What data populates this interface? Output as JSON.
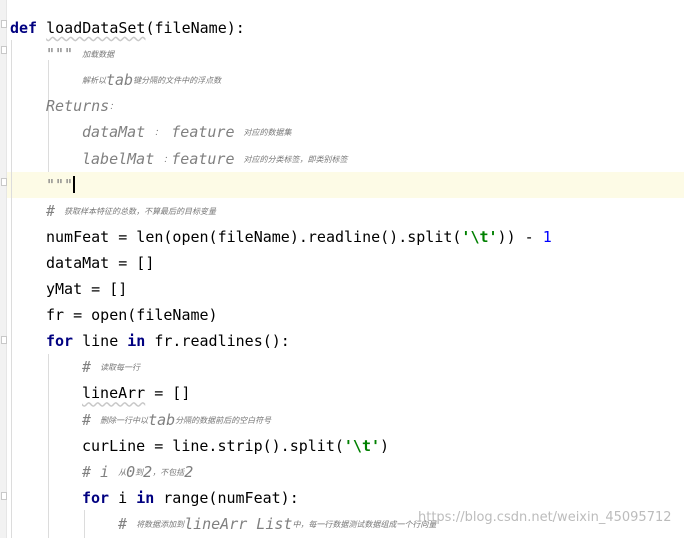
{
  "editor": {
    "lines": [
      {
        "id": "def",
        "indent": 0,
        "parts": [
          [
            "kw",
            "def "
          ],
          [
            "plain squig",
            "loadDataSet"
          ],
          [
            "plain",
            "(fileName):"
          ]
        ]
      },
      {
        "id": "doc-open",
        "indent": 1,
        "parts": [
          [
            "doc",
            "\"\"\" "
          ],
          [
            "tiny",
            "加载数据"
          ]
        ]
      },
      {
        "id": "doc-desc",
        "indent": 2,
        "parts": [
          [
            "tiny",
            "解析以"
          ],
          [
            "doc-i",
            "tab"
          ],
          [
            "tiny",
            "键分隔的文件中的浮点数"
          ]
        ]
      },
      {
        "id": "doc-returns",
        "indent": 1,
        "parts": [
          [
            "doc-i",
            "Returns"
          ],
          [
            "tiny",
            "："
          ]
        ]
      },
      {
        "id": "doc-datamat",
        "indent": 2,
        "parts": [
          [
            "doc-i",
            "dataMat "
          ],
          [
            "tiny",
            "："
          ],
          [
            "doc-i",
            " feature "
          ],
          [
            "tiny",
            "对应的数据集"
          ]
        ]
      },
      {
        "id": "doc-labelmat",
        "indent": 2,
        "parts": [
          [
            "doc-i",
            "labelMat "
          ],
          [
            "tiny",
            "："
          ],
          [
            "doc-i",
            "feature "
          ],
          [
            "tiny",
            "对应的分类标签，即类别标签"
          ]
        ]
      },
      {
        "id": "doc-close",
        "indent": 1,
        "parts": [
          [
            "doc",
            "\"\"\""
          ],
          [
            "caret",
            ""
          ]
        ]
      },
      {
        "id": "cmt-numfeat",
        "indent": 1,
        "parts": [
          [
            "cmt",
            "# "
          ],
          [
            "tiny",
            "获取样本特征的总数，不算最后的目标变量"
          ]
        ]
      },
      {
        "id": "numfeat",
        "indent": 1,
        "parts": [
          [
            "plain",
            "numFeat = len(open(fileName).readline().split("
          ],
          [
            "str",
            "'\\t'"
          ],
          [
            "plain",
            ")) - "
          ],
          [
            "num",
            "1"
          ]
        ]
      },
      {
        "id": "datamat",
        "indent": 1,
        "parts": [
          [
            "plain",
            "dataMat = []"
          ]
        ]
      },
      {
        "id": "ymat",
        "indent": 1,
        "parts": [
          [
            "plain",
            "yMat = []"
          ]
        ]
      },
      {
        "id": "fr",
        "indent": 1,
        "parts": [
          [
            "plain",
            "fr = open(fileName)"
          ]
        ]
      },
      {
        "id": "for-line",
        "indent": 1,
        "parts": [
          [
            "kw",
            "for "
          ],
          [
            "plain",
            "line "
          ],
          [
            "kw",
            "in "
          ],
          [
            "plain",
            "fr.readlines():"
          ]
        ]
      },
      {
        "id": "cmt-read",
        "indent": 2,
        "parts": [
          [
            "cmt",
            "# "
          ],
          [
            "tiny",
            "读取每一行"
          ]
        ]
      },
      {
        "id": "linearr",
        "indent": 2,
        "parts": [
          [
            "plain squig",
            "lineArr"
          ],
          [
            "plain",
            " = []"
          ]
        ]
      },
      {
        "id": "cmt-del",
        "indent": 2,
        "parts": [
          [
            "cmt",
            "# "
          ],
          [
            "tiny",
            "删除一行中以"
          ],
          [
            "cmt",
            "tab"
          ],
          [
            "tiny",
            "分隔的数据前后的空白符号"
          ]
        ]
      },
      {
        "id": "curline",
        "indent": 2,
        "parts": [
          [
            "plain",
            "curLine = line.strip().split("
          ],
          [
            "str",
            "'\\t'"
          ],
          [
            "plain",
            ")"
          ]
        ]
      },
      {
        "id": "cmt-i",
        "indent": 2,
        "parts": [
          [
            "cmt",
            "# i "
          ],
          [
            "tiny",
            "从"
          ],
          [
            "cmt",
            "0"
          ],
          [
            "tiny",
            "到"
          ],
          [
            "cmt",
            "2"
          ],
          [
            "tiny",
            "，不包括"
          ],
          [
            "cmt",
            "2"
          ]
        ]
      },
      {
        "id": "for-i",
        "indent": 2,
        "parts": [
          [
            "kw",
            "for "
          ],
          [
            "plain",
            "i "
          ],
          [
            "kw",
            "in "
          ],
          [
            "plain",
            "range(numFeat):"
          ]
        ]
      },
      {
        "id": "cmt-append",
        "indent": 3,
        "parts": [
          [
            "cmt",
            "# "
          ],
          [
            "tiny",
            "将数据添加到"
          ],
          [
            "cmt",
            "lineArr List"
          ],
          [
            "tiny",
            "中，每一行数据测试数据组成一个行向量"
          ]
        ]
      }
    ]
  },
  "watermark": "https://blog.csdn.net/weixin_45095712",
  "colors": {
    "keyword": "#000080",
    "string": "#008000",
    "number": "#0000ff",
    "comment": "#808080",
    "caret_line": "#fdfbe6"
  }
}
